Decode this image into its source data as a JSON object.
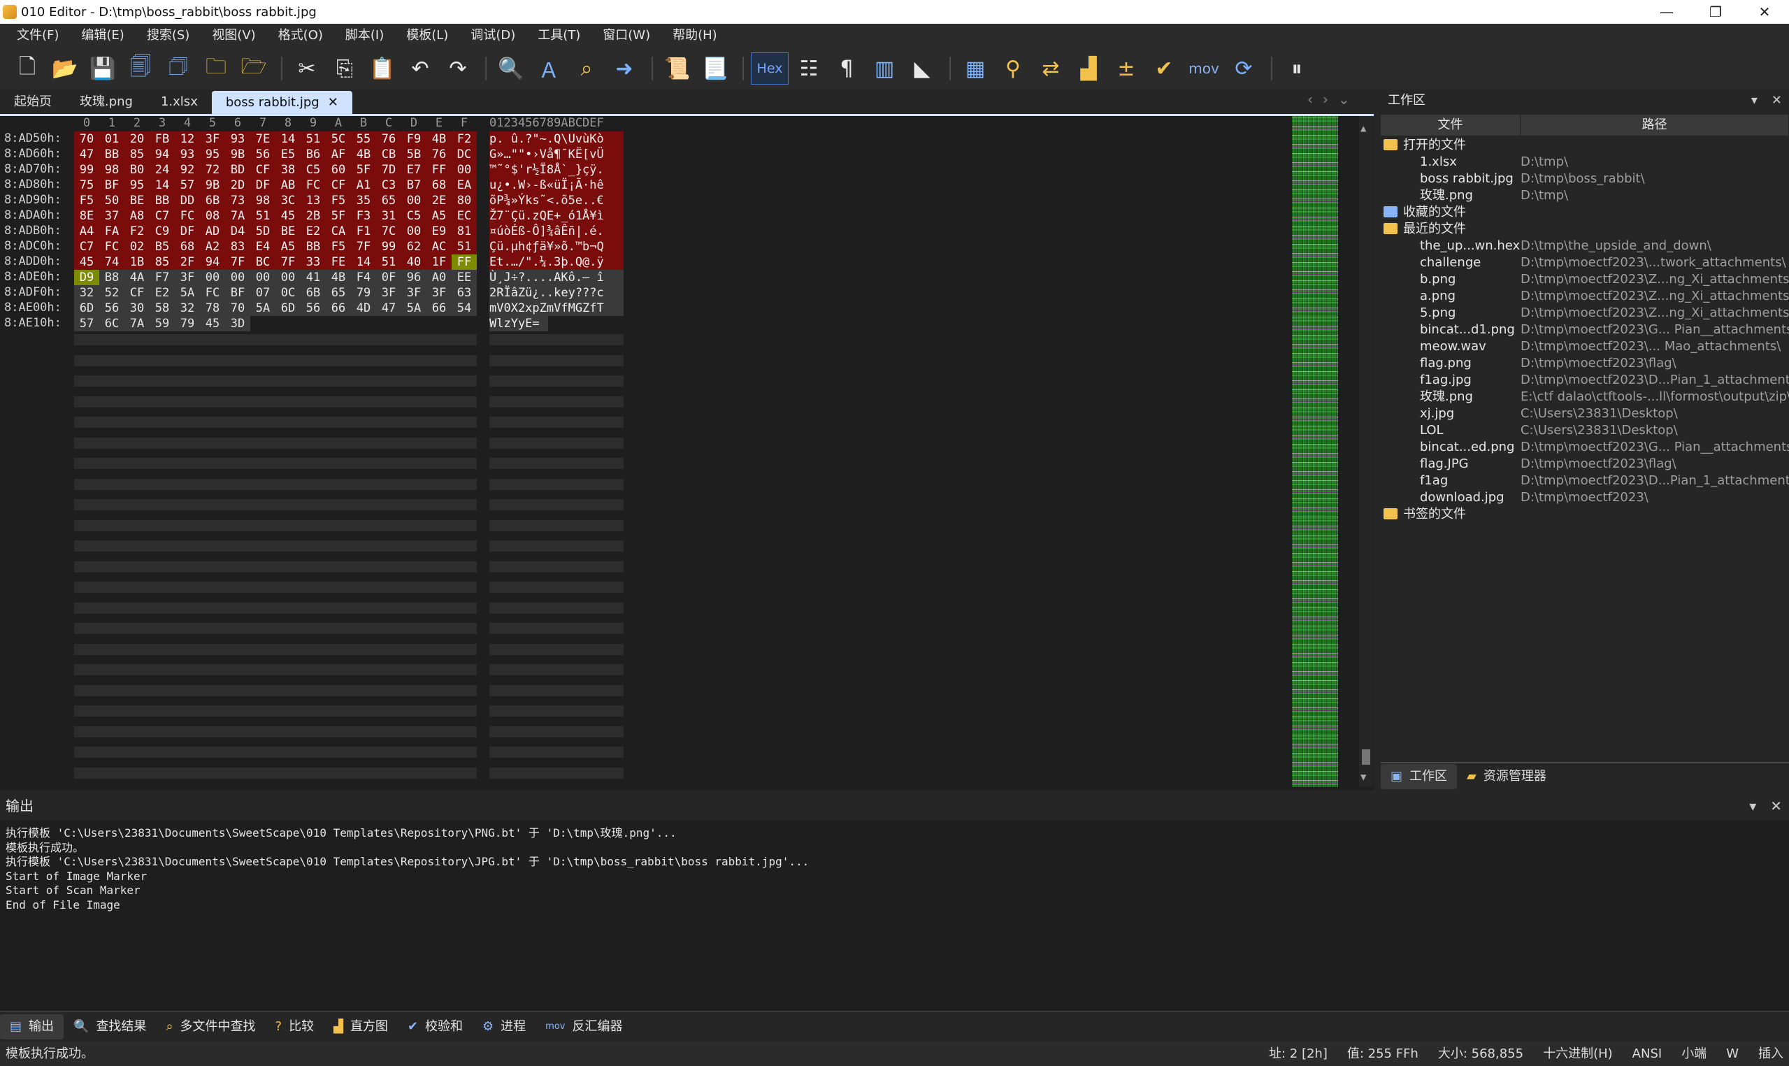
{
  "window": {
    "title": "010 Editor - D:\\tmp\\boss_rabbit\\boss rabbit.jpg",
    "controls": [
      "—",
      "❐",
      "✕"
    ]
  },
  "menu": [
    "文件(F)",
    "编辑(E)",
    "搜索(S)",
    "视图(V)",
    "格式(O)",
    "脚本(I)",
    "模板(L)",
    "调试(D)",
    "工具(T)",
    "窗口(W)",
    "帮助(H)"
  ],
  "toolbar": {
    "hex_label": "Hex",
    "mov_label": "mov"
  },
  "tabs": [
    {
      "label": "起始页",
      "active": false
    },
    {
      "label": "玫瑰.png",
      "active": false
    },
    {
      "label": "1.xlsx",
      "active": false
    },
    {
      "label": "boss rabbit.jpg",
      "active": true
    }
  ],
  "hex": {
    "header": "   0  1  2  3  4  5  6  7  8  9  A  B  C  D  E  F   0123456789ABCDEF",
    "rows": [
      {
        "addr": "8:AD50h:",
        "bytes": [
          "70",
          "01",
          "20",
          "FB",
          "12",
          "3F",
          "93",
          "7E",
          "14",
          "51",
          "5C",
          "55",
          "76",
          "F9",
          "4B",
          "F2"
        ],
        "ascii": "p. û.?\"~.Q\\UvùKò",
        "style": "r"
      },
      {
        "addr": "8:AD60h:",
        "bytes": [
          "47",
          "BB",
          "85",
          "94",
          "93",
          "95",
          "9B",
          "56",
          "E5",
          "B6",
          "AF",
          "4B",
          "CB",
          "5B",
          "76",
          "DC"
        ],
        "ascii": "G»…\"\"•›Vå¶¯KË[vÜ",
        "style": "r"
      },
      {
        "addr": "8:AD70h:",
        "bytes": [
          "99",
          "98",
          "B0",
          "24",
          "92",
          "72",
          "BD",
          "CF",
          "38",
          "C5",
          "60",
          "5F",
          "7D",
          "E7",
          "FF",
          "00"
        ],
        "ascii": "™˜°$'r½Ï8Å`_}çÿ.",
        "style": "r"
      },
      {
        "addr": "8:AD80h:",
        "bytes": [
          "75",
          "BF",
          "95",
          "14",
          "57",
          "9B",
          "2D",
          "DF",
          "AB",
          "FC",
          "CF",
          "A1",
          "C3",
          "B7",
          "68",
          "EA"
        ],
        "ascii": "u¿•.W›-ß«üÏ¡Ã·hê",
        "style": "r"
      },
      {
        "addr": "8:AD90h:",
        "bytes": [
          "F5",
          "50",
          "BE",
          "BB",
          "DD",
          "6B",
          "73",
          "98",
          "3C",
          "13",
          "F5",
          "35",
          "65",
          "00",
          "2E",
          "80"
        ],
        "ascii": "õP¾»Ýks˜<.õ5e..€",
        "style": "r"
      },
      {
        "addr": "8:ADA0h:",
        "bytes": [
          "8E",
          "37",
          "A8",
          "C7",
          "FC",
          "08",
          "7A",
          "51",
          "45",
          "2B",
          "5F",
          "F3",
          "31",
          "C5",
          "A5",
          "EC"
        ],
        "ascii": "Ž7¨Çü.zQE+_ó1Å¥ì",
        "style": "r"
      },
      {
        "addr": "8:ADB0h:",
        "bytes": [
          "A4",
          "FA",
          "F2",
          "C9",
          "DF",
          "AD",
          "D4",
          "5D",
          "BE",
          "E2",
          "CA",
          "F1",
          "7C",
          "00",
          "E9",
          "81"
        ],
        "ascii": "¤úòÉß-Ô]¾âÊñ|.é.",
        "style": "r"
      },
      {
        "addr": "8:ADC0h:",
        "bytes": [
          "C7",
          "FC",
          "02",
          "B5",
          "68",
          "A2",
          "83",
          "E4",
          "A5",
          "BB",
          "F5",
          "7F",
          "99",
          "62",
          "AC",
          "51"
        ],
        "ascii": "Çü.µh¢ƒä¥»õ.™b¬Q",
        "style": "r"
      },
      {
        "addr": "8:ADD0h:",
        "bytes": [
          "45",
          "74",
          "1B",
          "85",
          "2F",
          "94",
          "7F",
          "BC",
          "7F",
          "33",
          "FE",
          "14",
          "51",
          "40",
          "1F",
          "FF"
        ],
        "ascii": "Et.…/\".¼.3þ.Q@.ÿ",
        "style": "r"
      },
      {
        "addr": "8:ADE0h:",
        "bytes": [
          "D9",
          "B8",
          "4A",
          "F7",
          "3F",
          "00",
          "00",
          "00",
          "00",
          "41",
          "4B",
          "F4",
          "0F",
          "96",
          "A0",
          "EE"
        ],
        "ascii": "Ù¸J÷?....AKô.– î",
        "style": "g"
      },
      {
        "addr": "8:ADF0h:",
        "bytes": [
          "32",
          "52",
          "CF",
          "E2",
          "5A",
          "FC",
          "BF",
          "07",
          "0C",
          "6B",
          "65",
          "79",
          "3F",
          "3F",
          "3F",
          "63"
        ],
        "ascii": "2RÏâZü¿..key???c",
        "style": "g"
      },
      {
        "addr": "8:AE00h:",
        "bytes": [
          "6D",
          "56",
          "30",
          "58",
          "32",
          "78",
          "70",
          "5A",
          "6D",
          "56",
          "66",
          "4D",
          "47",
          "5A",
          "66",
          "54"
        ],
        "ascii": "mV0X2xpZmVfMGZfT",
        "style": "g"
      },
      {
        "addr": "8:AE10h:",
        "bytes": [
          "57",
          "6C",
          "7A",
          "59",
          "79",
          "45",
          "3D"
        ],
        "ascii": "WlzYyE=",
        "style": "g"
      }
    ]
  },
  "workspace": {
    "title": "工作区",
    "col_file": "文件",
    "col_path": "路径",
    "groups": {
      "open": "打开的文件",
      "fav": "收藏的文件",
      "recent": "最近的文件",
      "bookmark": "书签的文件"
    },
    "open_files": [
      {
        "name": "1.xlsx",
        "path": "D:\\tmp\\"
      },
      {
        "name": "boss rabbit.jpg",
        "path": "D:\\tmp\\boss_rabbit\\"
      },
      {
        "name": "玫瑰.png",
        "path": "D:\\tmp\\"
      }
    ],
    "recent_files": [
      {
        "name": "the_up...wn.hex",
        "path": "D:\\tmp\\the_upside_and_down\\"
      },
      {
        "name": "challenge",
        "path": "D:\\tmp\\moectf2023\\...twork_attachments\\"
      },
      {
        "name": "b.png",
        "path": "D:\\tmp\\moectf2023\\Z...ng_Xi_attachments\\"
      },
      {
        "name": "a.png",
        "path": "D:\\tmp\\moectf2023\\Z...ng_Xi_attachments\\"
      },
      {
        "name": "5.png",
        "path": "D:\\tmp\\moectf2023\\Z...ng_Xi_attachments\\"
      },
      {
        "name": "bincat...d1.png",
        "path": "D:\\tmp\\moectf2023\\G... Pian__attachments\\"
      },
      {
        "name": "meow.wav",
        "path": "D:\\tmp\\moectf2023\\... Mao_attachments\\"
      },
      {
        "name": "flag.png",
        "path": "D:\\tmp\\moectf2023\\flag\\"
      },
      {
        "name": "f1ag.jpg",
        "path": "D:\\tmp\\moectf2023\\D...Pian_1_attachments\\"
      },
      {
        "name": "玫瑰.png",
        "path": "E:\\ctf dalao\\ctftools-...ll\\formost\\output\\zip\\"
      },
      {
        "name": "xj.jpg",
        "path": "C:\\Users\\23831\\Desktop\\"
      },
      {
        "name": "LOL",
        "path": "C:\\Users\\23831\\Desktop\\"
      },
      {
        "name": "bincat...ed.png",
        "path": "D:\\tmp\\moectf2023\\G... Pian__attachments\\"
      },
      {
        "name": "flag.JPG",
        "path": "D:\\tmp\\moectf2023\\flag\\"
      },
      {
        "name": "f1ag",
        "path": "D:\\tmp\\moectf2023\\D...Pian_1_attachments\\"
      },
      {
        "name": "download.jpg",
        "path": "D:\\tmp\\moectf2023\\"
      }
    ],
    "bottom_tabs": [
      "工作区",
      "资源管理器"
    ]
  },
  "output": {
    "title": "输出",
    "lines": [
      "执行模板 'C:\\Users\\23831\\Documents\\SweetScape\\010 Templates\\Repository\\PNG.bt' 于 'D:\\tmp\\玫瑰.png'...",
      "模板执行成功。",
      "执行模板 'C:\\Users\\23831\\Documents\\SweetScape\\010 Templates\\Repository\\JPG.bt' 于 'D:\\tmp\\boss_rabbit\\boss rabbit.jpg'...",
      "Start of Image Marker",
      "Start of Scan Marker",
      "End of File Image"
    ]
  },
  "bottom_tabs": [
    "输出",
    "查找结果",
    "多文件中查找",
    "比较",
    "直方图",
    "校验和",
    "进程",
    "反汇编器"
  ],
  "status": {
    "left": "模板执行成功。",
    "addr": "址: 2 [2h]",
    "value": "值: 255 FFh",
    "size": "大小: 568,855",
    "mode": "十六进制(H)",
    "encoding": "ANSI",
    "endian": "小端",
    "w": "W",
    "insert": "插入"
  }
}
